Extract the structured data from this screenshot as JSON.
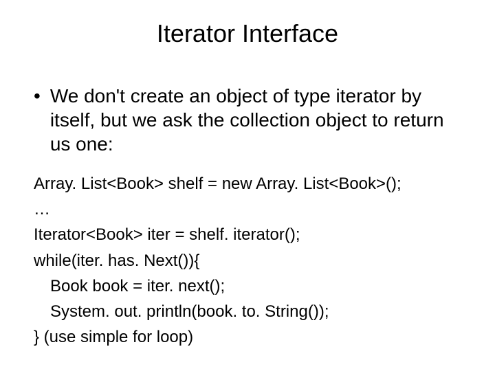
{
  "slide": {
    "title": "Iterator Interface",
    "bullet": {
      "marker": "•",
      "text": "We don't create an object of type iterator by itself, but we ask the collection object to return us one:"
    },
    "code": {
      "line1": "Array. List<Book> shelf = new Array. List<Book>();",
      "line2": "…",
      "line3": "Iterator<Book> iter = shelf. iterator();",
      "line4": "while(iter. has. Next()){",
      "line5": "Book book = iter. next();",
      "line6": "System. out. println(book. to. String());",
      "line7": "} (use simple for loop)"
    }
  }
}
